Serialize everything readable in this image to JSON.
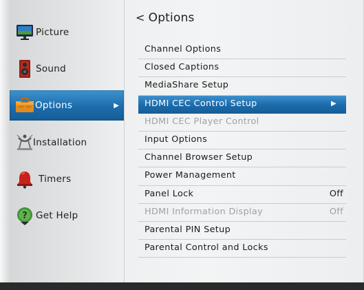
{
  "sidebar": {
    "items": [
      {
        "label": "Picture",
        "icon": "monitor-icon"
      },
      {
        "label": "Sound",
        "icon": "speaker-icon"
      },
      {
        "label": "Options",
        "icon": "options-toolbox-icon"
      },
      {
        "label": "Installation",
        "icon": "satellite-dish-icon"
      },
      {
        "label": "Timers",
        "icon": "alarm-bell-icon"
      },
      {
        "label": "Get Help",
        "icon": "help-question-icon"
      }
    ],
    "active_index": 2,
    "arrow": "▶"
  },
  "header": {
    "chevron": "<",
    "title": "Options"
  },
  "menu": {
    "items": [
      {
        "label": "Channel Options",
        "value": "",
        "state": "normal"
      },
      {
        "label": "Closed Captions",
        "value": "",
        "state": "normal"
      },
      {
        "label": "MediaShare Setup",
        "value": "",
        "state": "normal"
      },
      {
        "label": "HDMI CEC Control Setup",
        "value": "",
        "state": "selected"
      },
      {
        "label": "HDMI CEC Player Control",
        "value": "",
        "state": "disabled"
      },
      {
        "label": "Input Options",
        "value": "",
        "state": "normal"
      },
      {
        "label": "Channel Browser Setup",
        "value": "",
        "state": "normal"
      },
      {
        "label": "Power Management",
        "value": "",
        "state": "normal"
      },
      {
        "label": "Panel Lock",
        "value": "Off",
        "state": "normal"
      },
      {
        "label": "HDMI Information Display",
        "value": "Off",
        "state": "disabled"
      },
      {
        "label": "Parental PIN Setup",
        "value": "",
        "state": "normal"
      },
      {
        "label": "Parental Control and Locks",
        "value": "",
        "state": "normal"
      }
    ],
    "selected_arrow": "▶"
  },
  "colors": {
    "accent": "#1c6cac",
    "disabled_text": "#9ea1a4",
    "text": "#1a1a1a"
  }
}
